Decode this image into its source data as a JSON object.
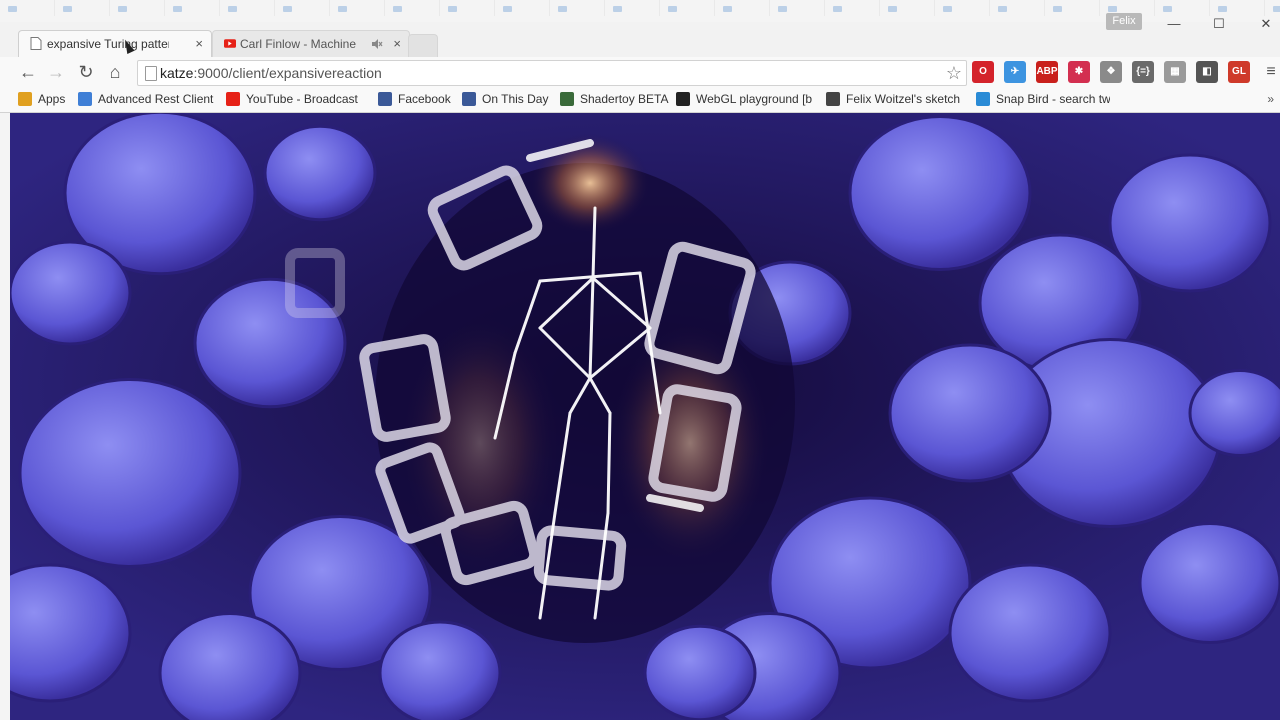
{
  "profile": {
    "name": "Felix"
  },
  "window_controls": {
    "minimize": "—",
    "maximize": "☐",
    "close": "✕"
  },
  "tabs": [
    {
      "title": "expansive Turing pattern",
      "close": "×",
      "active": true
    },
    {
      "title": "Carl Finlow - Machine",
      "close": "×",
      "active": false,
      "audio_icon": "speaker-muted-icon"
    }
  ],
  "toolbar": {
    "back": "←",
    "forward": "→",
    "reload": "↻",
    "home": "⌂",
    "url_host": "katze",
    "url_path": ":9000/client/expansivereaction",
    "star": "☆",
    "menu": "≡"
  },
  "extensions": [
    {
      "name": "opera-icon",
      "label": "O",
      "color": "#d4232b"
    },
    {
      "name": "bird-icon",
      "label": "✈",
      "color": "#3d94e0"
    },
    {
      "name": "adblock-plus-icon",
      "label": "ABP",
      "color": "#c9201c"
    },
    {
      "name": "puzzle-icon",
      "label": "✱",
      "color": "#d32f50"
    },
    {
      "name": "dropbox-icon",
      "label": "❖",
      "color": "#8a8a8a"
    },
    {
      "name": "json-viewer-icon",
      "label": "{=}",
      "color": "#6a6a6a"
    },
    {
      "name": "grid-icon",
      "label": "▦",
      "color": "#9a9a9a"
    },
    {
      "name": "dark-app-icon",
      "label": "◧",
      "color": "#555555"
    },
    {
      "name": "webgl-icon",
      "label": "GL",
      "color": "#cf3a2a"
    }
  ],
  "bookmarks": [
    {
      "label": "Apps",
      "icon": "apps-grid-icon",
      "color": "#e0a020"
    },
    {
      "label": "Advanced Rest Client",
      "icon": "arc-icon",
      "color": "#3f7fd6"
    },
    {
      "label": "YouTube - Broadcast",
      "icon": "youtube-icon",
      "color": "#e62117"
    },
    {
      "label": "Facebook",
      "icon": "facebook-icon",
      "color": "#3b5998"
    },
    {
      "label": "On This Day",
      "icon": "facebook-icon",
      "color": "#3b5998"
    },
    {
      "label": "Shadertoy BETA",
      "icon": "shadertoy-icon",
      "color": "#3a6a3a"
    },
    {
      "label": "WebGL playground [b",
      "icon": "webgl-playground-icon",
      "color": "#222222"
    },
    {
      "label": "Felix Woitzel's sketch",
      "icon": "sketch-icon",
      "color": "#444444"
    },
    {
      "label": "Snap Bird - search tw",
      "icon": "snapbird-icon",
      "color": "#2a8bd6"
    }
  ],
  "bookmarks_more": "»",
  "content": {
    "colors": {
      "base": "#2a1d6e",
      "cell": "#5a5ad8",
      "light": "#8c8cf0",
      "glow": "#ffb070"
    }
  }
}
